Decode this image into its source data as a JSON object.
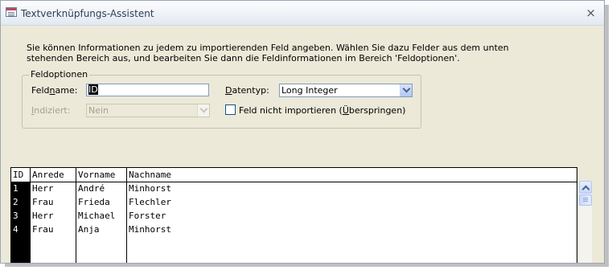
{
  "window": {
    "title": "Textverknüpfungs-Assistent",
    "close_glyph": "×"
  },
  "intro_text": "Sie können Informationen zu jedem zu importierenden Feld angeben. Wählen Sie dazu Felder aus dem unten stehenden Bereich aus, und bearbeiten Sie dann die Feldinformationen im Bereich 'Feldoptionen'.",
  "field_options": {
    "legend": "Feldoptionen",
    "fieldname_label_pre": "Feld",
    "fieldname_label_u": "n",
    "fieldname_label_post": "ame:",
    "fieldname_value": "ID",
    "datatype_label_u": "D",
    "datatype_label_post": "atentyp:",
    "datatype_value": "Long Integer",
    "indexed_label_u": "I",
    "indexed_label_post": "ndiziert:",
    "indexed_value": "Nein",
    "skip_label_pre": "Feld nicht importieren (",
    "skip_label_u": "Ü",
    "skip_label_post": "berspringen)",
    "skip_checked": false
  },
  "grid": {
    "columns": [
      "ID",
      "Anrede",
      "Vorname",
      "Nachname"
    ],
    "rows": [
      [
        "1",
        "Herr",
        "André",
        "Minhorst"
      ],
      [
        "2",
        "Frau",
        "Frieda",
        "Flechler"
      ],
      [
        "3",
        "Herr",
        "Michael",
        "Forster"
      ],
      [
        "4",
        "Frau",
        "Anja",
        "Minhorst"
      ]
    ]
  }
}
